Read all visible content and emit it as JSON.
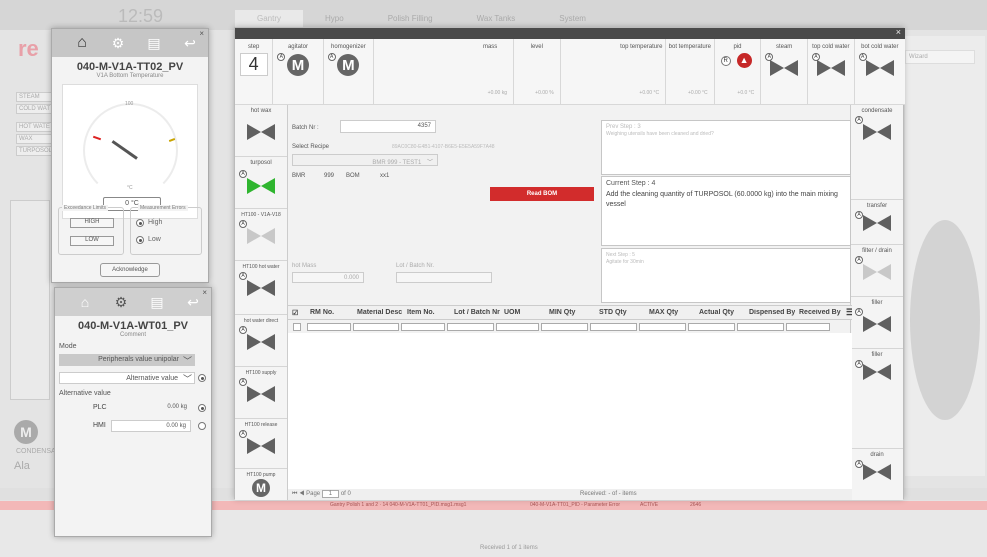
{
  "background": {
    "logo": "re",
    "clock": "12:59",
    "tabs": [
      "Gantry",
      "Hypo",
      "Polish Filling",
      "Wax Tanks",
      "System"
    ],
    "left_list": [
      "STEAM",
      "COLD WAT",
      "HOT WATE",
      "WAX",
      "TURPOSOL"
    ],
    "condensate": "CONDENSAT",
    "alarm_label": "Ala",
    "status_row": "Gantry Polish 1 and 2 · 14 040-M-V1A-TT01_PID.msg1.msg1",
    "status_row_b": "040-M-V1A-TT01_PID - Parameter Error",
    "status_row_c": "ACTIVE",
    "status_row_d": "2646",
    "received_bottom": "Received 1 of 1 items",
    "right_field": "Wizard",
    "page_indicator": "2"
  },
  "main": {
    "close": "×",
    "step": {
      "label": "step",
      "value": "4"
    },
    "equipment": [
      {
        "label": "agitator",
        "type": "motor",
        "glyph": "M"
      },
      {
        "label": "homogenizer",
        "type": "motor",
        "glyph": "M"
      },
      {
        "label": "mass",
        "value": "+0.00 kg"
      },
      {
        "label": "level",
        "value": "+0.00 %"
      },
      {
        "label": "top temperature",
        "value": "+0.00 °C"
      },
      {
        "label": "bot temperature",
        "value": "+0.00 °C"
      },
      {
        "label": "pid",
        "value": "+0.0 °C"
      },
      {
        "label": "steam",
        "type": "valve"
      },
      {
        "label": "top cold water",
        "type": "valve"
      },
      {
        "label": "bot cold water",
        "type": "valve"
      }
    ],
    "left_side": [
      {
        "label": "hot wax",
        "type": "valve"
      },
      {
        "label": "turposol",
        "type": "valve-green"
      },
      {
        "label": "HT100 - V1A-V18",
        "type": "valve-light"
      },
      {
        "label": "HT100 hot water",
        "type": "valve"
      },
      {
        "label": "hot water direct",
        "type": "valve"
      },
      {
        "label": "HT100 supply",
        "type": "valve"
      },
      {
        "label": "HT100 release",
        "type": "valve"
      },
      {
        "label": "HT100 pump",
        "type": "motor",
        "glyph": "M"
      }
    ],
    "right_side": [
      {
        "label": "condensate",
        "type": "valve"
      },
      {
        "label": "transfer",
        "type": "valve"
      },
      {
        "label": "filter / drain",
        "type": "valve-light"
      },
      {
        "label": "filler",
        "type": "valve"
      },
      {
        "label": "filler",
        "type": "valve"
      },
      {
        "label": "drain",
        "type": "valve"
      }
    ],
    "form": {
      "batch_label": "Batch Nr :",
      "batch_value": "4357",
      "recipe_label": "Select Recipe",
      "recipe_id": "89AC0C80-E4B1-4107-B6E5-E5E5A59F7A48",
      "recipe_value": "BMR 999 - TEST1",
      "bmr_label": "BMR",
      "bmr_value": "999",
      "bom_label": "BOM",
      "bom_value": "xx1",
      "read_bom": "Read BOM",
      "hot_mass_label": "hot Mass",
      "hot_mass_value": "0.000",
      "lot_label": "Lot / Batch Nr."
    },
    "prev_step": {
      "title": "Prev Step : 3",
      "text": "Weighing utensils have been cleaned and dried?"
    },
    "current_step": {
      "title": "Current Step : 4",
      "text": "Add the cleaning quantity of TURPOSOL (60.0000 kg) into the main mixing vessel"
    },
    "next_step": {
      "title": "Next Step : 5",
      "text": "Agitate for 30min"
    },
    "table": {
      "columns": [
        "RM No.",
        "Material Desc",
        "Item No.",
        "Lot / Batch Nr.",
        "UOM",
        "MIN Qty",
        "STD Qty",
        "MAX Qty",
        "Actual Qty",
        "Dispensed By",
        "Received By"
      ],
      "pager_label": "Page",
      "page": "1",
      "page_of": "of 0",
      "received": "Received: - of - items"
    }
  },
  "popup_tt": {
    "name": "040-M-V1A-TT02_PV",
    "comment": "V1A Bottom Temperature",
    "gauge_top": "100",
    "gauge_unit": "°C",
    "value": "0 °C",
    "exceedance_label": "Exceedance Limits",
    "high_btn": "HIGH",
    "low_btn": "LOW",
    "measurement_label": "Measurement Errors",
    "opt_high": "High",
    "opt_low": "Low",
    "acknowledge": "Acknowledge",
    "close": "×"
  },
  "popup_wt": {
    "name": "040-M-V1A-WT01_PV",
    "comment": "Comment",
    "mode_label": "Mode",
    "mode_value": "Peripherals value unipolar",
    "alt_select": "Alternative value",
    "alt_section": "Alternative value",
    "plc_label": "PLC",
    "plc_value": "0.00 kg",
    "hmi_label": "HMI",
    "hmi_value": "0.00 kg",
    "close": "×"
  }
}
